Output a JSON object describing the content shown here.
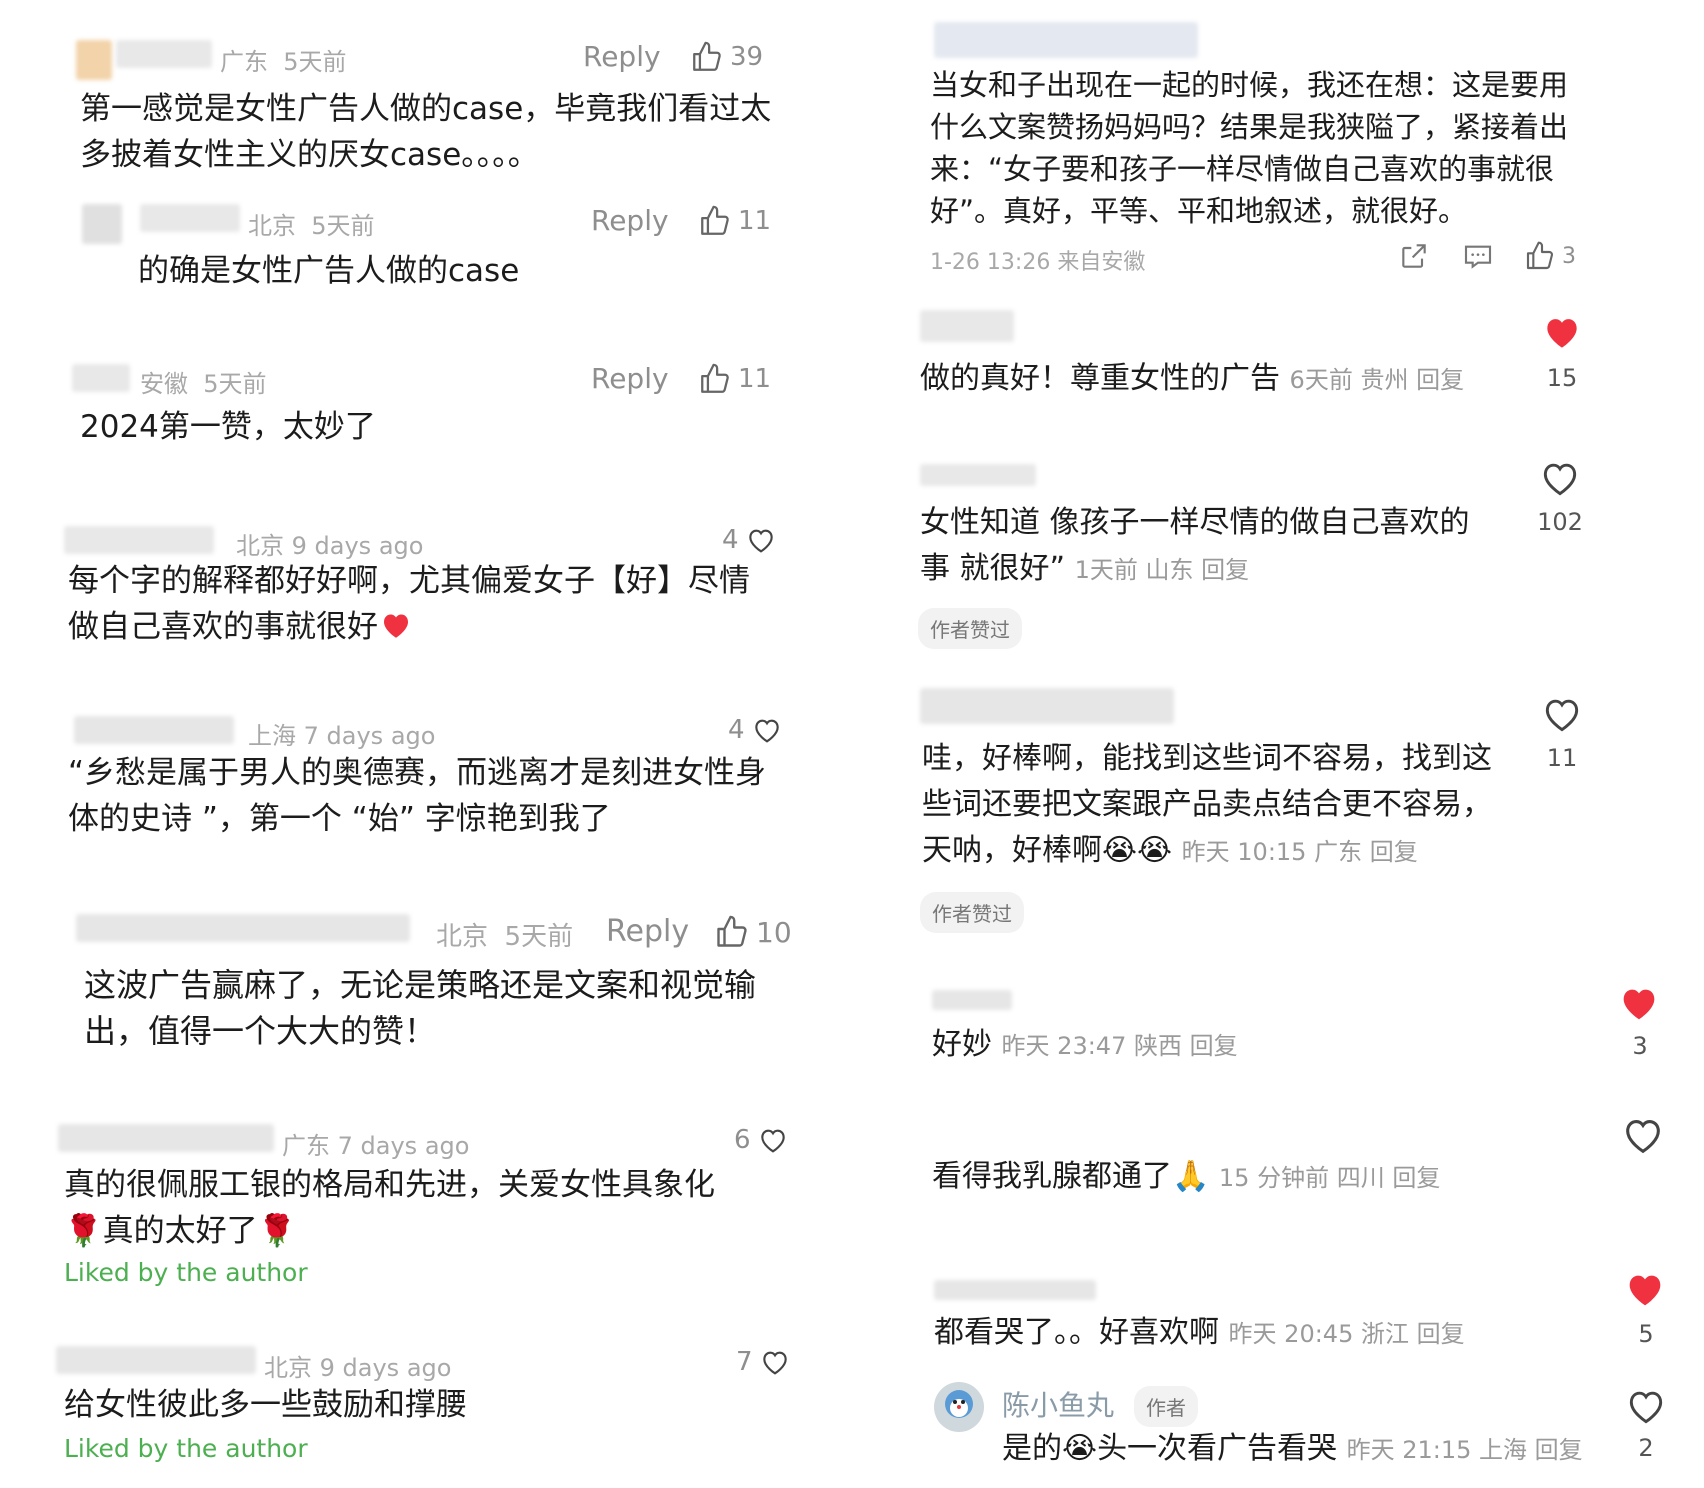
{
  "left": {
    "c1": {
      "loc": "广东",
      "time": "5天前",
      "reply": "Reply",
      "likes": "39",
      "text": "第一感觉是女性广告人做的case，毕竟我们看过太多披着女性主义的厌女case。。。。",
      "sub": {
        "loc": "北京",
        "time": "5天前",
        "reply": "Reply",
        "likes": "11",
        "text": "的确是女性广告人做的case"
      }
    },
    "c2": {
      "loc": "安徽",
      "time": "5天前",
      "reply": "Reply",
      "likes": "11",
      "text": "2024第一赞，太妙了"
    },
    "c3": {
      "loc": "北京",
      "time": "9 days ago",
      "likes": "4",
      "text": "每个字的解释都好好啊，尤其偏爱女子【好】尽情做自己喜欢的事就很好"
    },
    "c4": {
      "loc": "上海",
      "time": "7 days ago",
      "likes": "4",
      "text": "“乡愁是属于男人的奥德赛，而逃离才是刻进女性身体的史诗 ”，第一个 “始” 字惊艳到我了"
    },
    "c5": {
      "loc": "北京",
      "time": "5天前",
      "reply": "Reply",
      "likes": "10",
      "text": "这波广告赢麻了，无论是策略还是文案和视觉输出，值得一个大大的赞！"
    },
    "c6": {
      "loc": "广东",
      "time": "7 days ago",
      "likes": "6",
      "text_a": "真的很佩服工银的格局和先进，关爱女性具象化",
      "text_b": "真的太好了",
      "liked_by": "Liked by the author"
    },
    "c7": {
      "loc": "北京",
      "time": "9 days ago",
      "likes": "7",
      "text": "给女性彼此多一些鼓励和撑腰",
      "liked_by": "Liked by the author"
    }
  },
  "right": {
    "r1": {
      "text": "当女和子出现在一起的时候，我还在想：这是要用什么文案赞扬妈妈吗？结果是我狭隘了，紧接着出来：“女子要和孩子一样尽情做自己喜欢的事就很好”。真好，平等、平和地叙述，就很好。",
      "meta": "1-26 13:26 来自安徽",
      "likes": "3"
    },
    "r2": {
      "text": "做的真好！尊重女性的广告",
      "meta": "6天前 贵州 回复",
      "likes": "15"
    },
    "r3": {
      "text": "女性知道 像孩子一样尽情的做自己喜欢的事 就很好”",
      "meta": "1天前 山东 回复",
      "likes": "102",
      "tag": "作者赞过"
    },
    "r4": {
      "text": "哇，好棒啊，能找到这些词不容易，找到这些词还要把文案跟产品卖点结合更不容易，天呐，好棒啊",
      "meta": "昨天 10:15 广东 回复",
      "likes": "11",
      "tag": "作者赞过"
    },
    "r5": {
      "text": "好妙",
      "meta": "昨天 23:47 陕西 回复",
      "likes": "3"
    },
    "r6": {
      "text": "看得我乳腺都通了",
      "meta": "15 分钟前 四川 回复",
      "likes": ""
    },
    "r7": {
      "text": "都看哭了。。好喜欢啊",
      "meta": "昨天 20:45 浙江 回复",
      "likes": "5"
    },
    "r8": {
      "author": "陈小鱼丸",
      "badge": "作者",
      "text_a": "是的",
      "text_b": "头一次看广告看哭",
      "meta": "昨天 21:15 上海 回复",
      "likes": "2"
    }
  },
  "colors": {
    "accent_red": "#f0313f",
    "liked_green": "#4caf50",
    "meta_gray": "#a8a8a8"
  },
  "icons": [
    "thumbs-up-icon",
    "heart-outline-icon",
    "heart-filled-icon",
    "share-icon",
    "comment-icon",
    "red-heart-emoji",
    "rose-emoji",
    "crying-emoji",
    "clap-emoji"
  ]
}
